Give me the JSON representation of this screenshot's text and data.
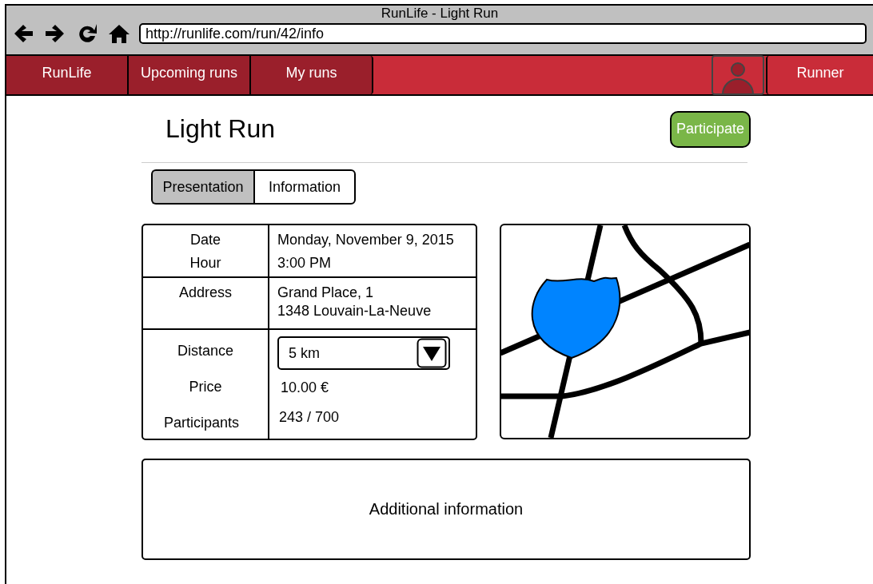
{
  "window": {
    "title": "RunLife - Light Run",
    "url": "http://runlife.com/run/42/info"
  },
  "nav": {
    "items": [
      {
        "label": "RunLife"
      },
      {
        "label": "Upcoming runs"
      },
      {
        "label": "My runs"
      }
    ],
    "user": "Runner"
  },
  "page": {
    "title": "Light Run",
    "action": "Participate"
  },
  "tabs": [
    {
      "label": "Presentation",
      "selected": true
    },
    {
      "label": "Information",
      "selected": false
    }
  ],
  "details": {
    "when": {
      "labels": [
        "Date",
        "Hour"
      ],
      "values": [
        "Monday, November 9, 2015",
        "3:00 PM"
      ]
    },
    "address": {
      "label": "Address",
      "lines": [
        "Grand Place, 1",
        "1348 Louvain-La-Neuve"
      ]
    },
    "distance": {
      "label": "Distance",
      "value": "5 km"
    },
    "price": {
      "label": "Price",
      "value": "10.00 €"
    },
    "participants": {
      "label": "Participants",
      "value": "243 / 700"
    }
  },
  "additional": "Additional information"
}
